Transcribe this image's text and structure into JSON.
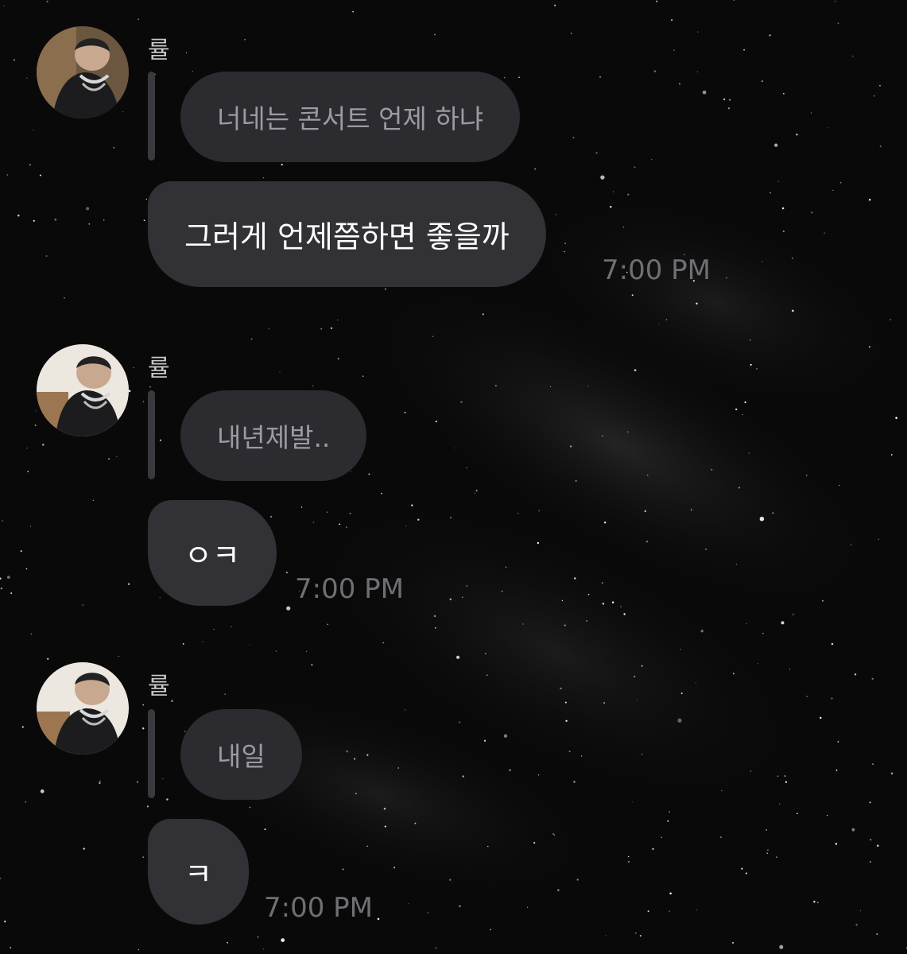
{
  "messages": [
    {
      "sender": "률",
      "quote": "너네는 콘서트 언제 하냐",
      "text": "그러게 언제쯤하면 좋을까",
      "time": "7:00 PM"
    },
    {
      "sender": "률",
      "quote": "내년제발..",
      "text": "ㅇㅋ",
      "time": "7:00 PM"
    },
    {
      "sender": "률",
      "quote": "내일",
      "text": "ㅋ",
      "time": "7:00 PM"
    }
  ],
  "colors": {
    "background": "#090909",
    "bubble": "#313136",
    "quote_bubble": "#2b2b30",
    "time": "#6f6f75"
  },
  "icons": {
    "avatar": "profile-photo"
  }
}
